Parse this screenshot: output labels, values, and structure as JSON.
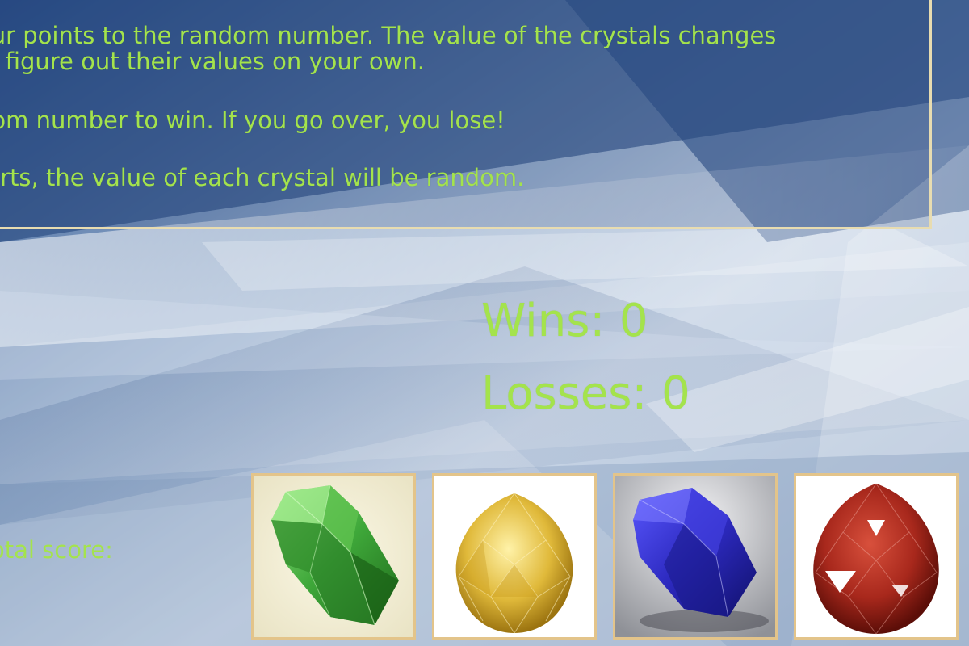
{
  "instructions": {
    "line1": "our points to the random number. The value of the crystals changes",
    "line2": "st figure out their values on your own.",
    "line3": "dom number to win. If you go over, you lose!",
    "line4": "tarts, the value of each crystal will be random."
  },
  "scoreboard": {
    "wins": "Wins: 0",
    "losses": "Losses: 0",
    "total_score_label": "otal score:"
  },
  "crystals": [
    {
      "name": "green crystal",
      "color": "#3fa83a"
    },
    {
      "name": "yellow crystal",
      "color": "#e0b93a"
    },
    {
      "name": "blue crystal",
      "color": "#2d2ac0"
    },
    {
      "name": "red crystal",
      "color": "#a8281c"
    }
  ],
  "colors": {
    "text_accent": "#a4e34c",
    "panel_border": "#e8dcb0",
    "crystal_border": "#e3c48a"
  }
}
